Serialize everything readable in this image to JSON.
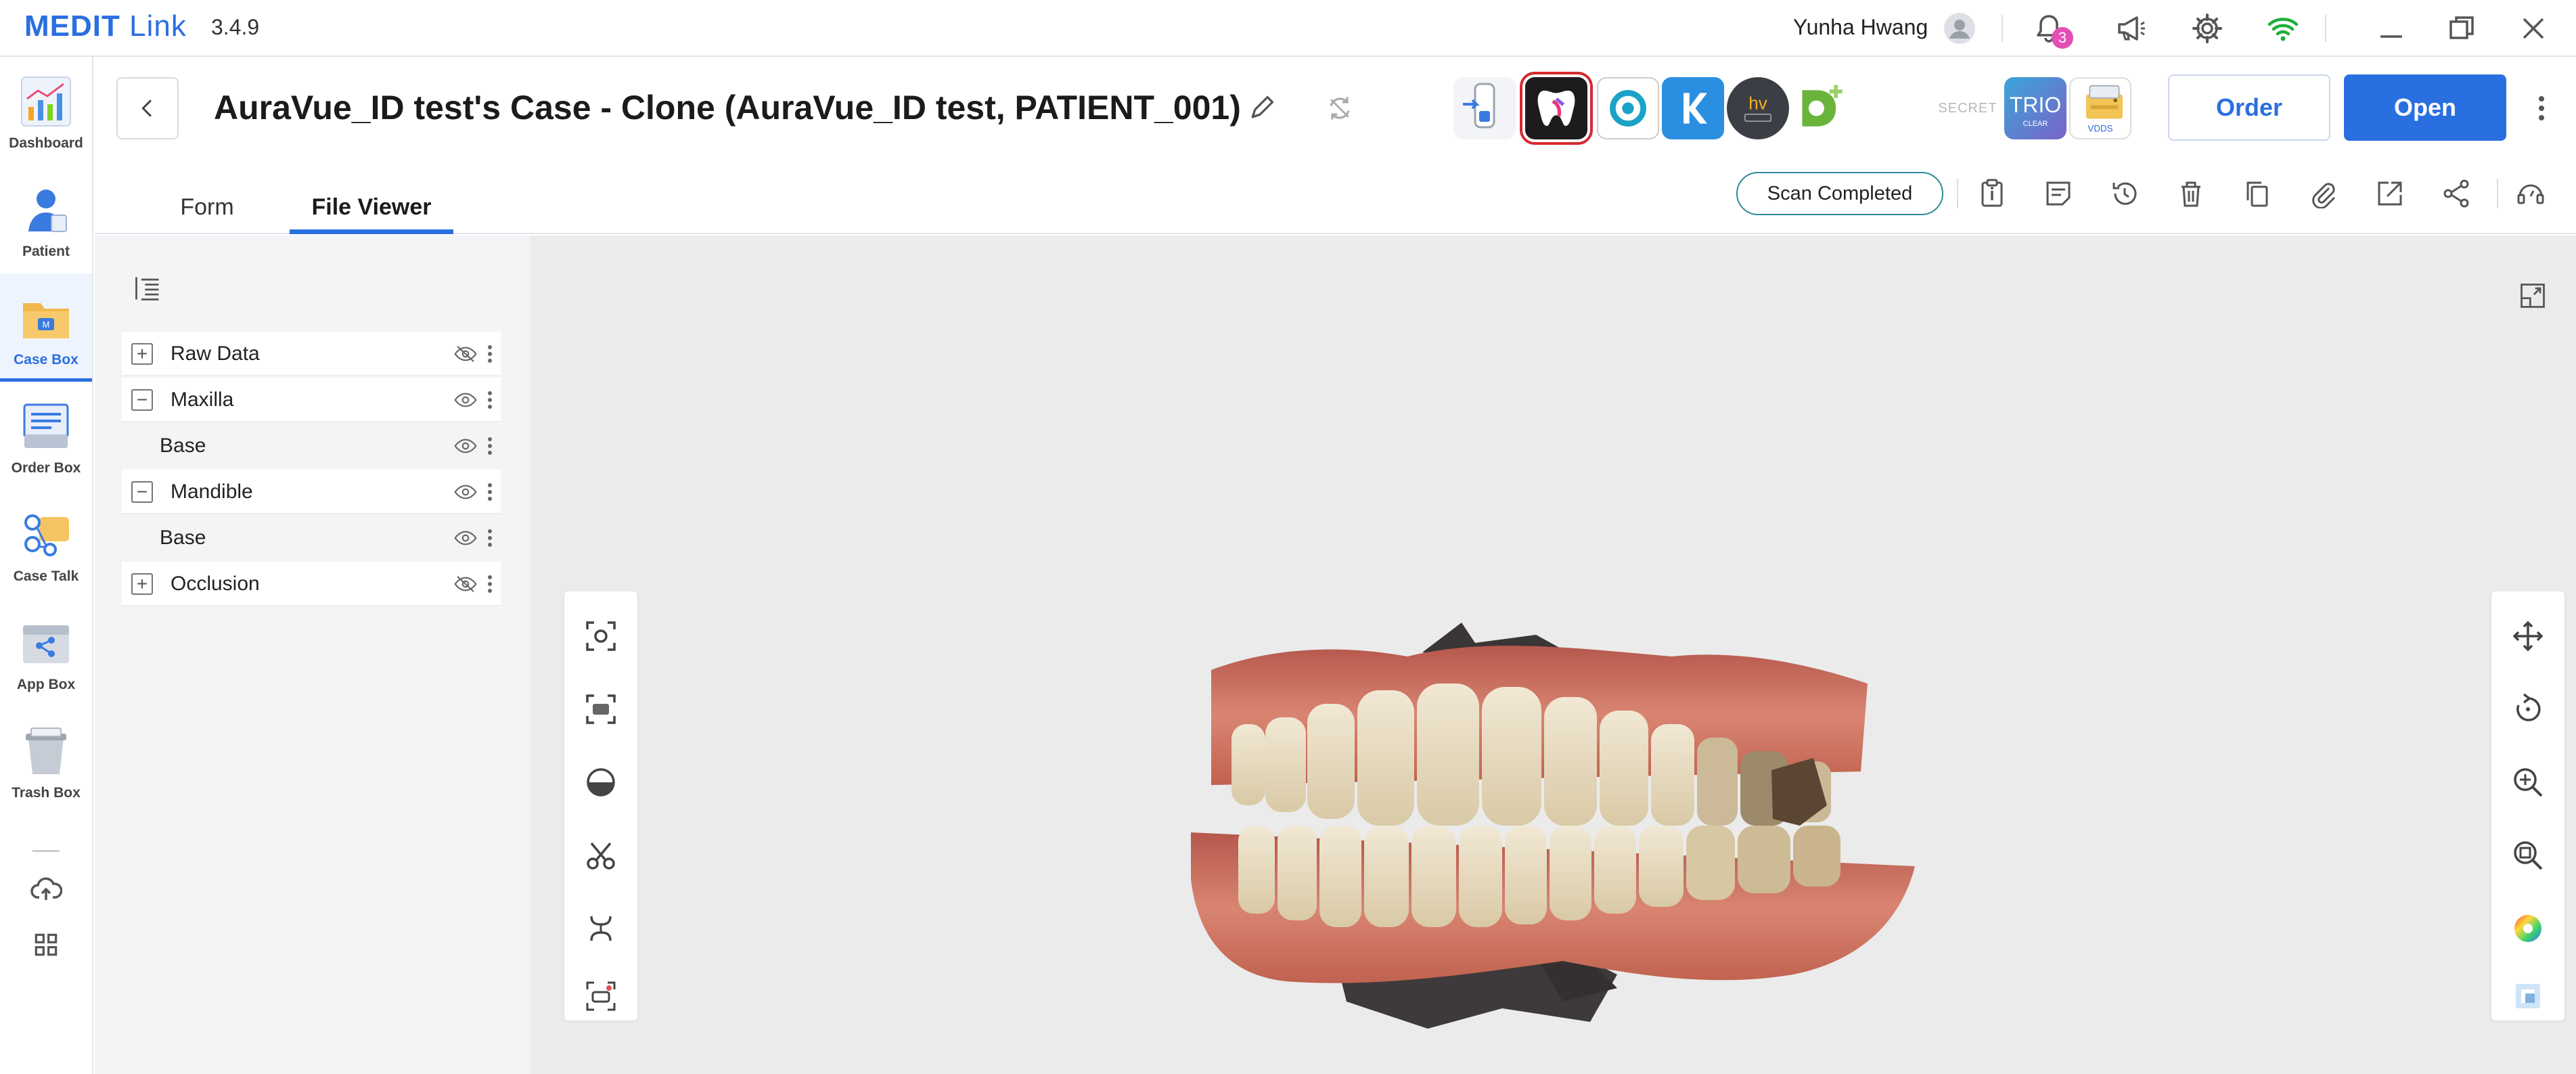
{
  "app": {
    "name_bold": "MEDIT",
    "name_rest": " Link",
    "version": "3.4.9"
  },
  "titlebar": {
    "user_name": "Yunha Hwang",
    "notification_count": "3",
    "icons": [
      "avatar-icon",
      "bell-icon",
      "megaphone-icon",
      "gear-icon",
      "wifi-icon",
      "minimize-icon",
      "restore-icon",
      "close-icon"
    ]
  },
  "sidebar": {
    "items": [
      {
        "label": "Dashboard",
        "icon": "dashboard-icon"
      },
      {
        "label": "Patient",
        "icon": "patient-icon"
      },
      {
        "label": "Case Box",
        "icon": "case-box-icon",
        "active": true
      },
      {
        "label": "Order Box",
        "icon": "order-box-icon"
      },
      {
        "label": "Case Talk",
        "icon": "case-talk-icon"
      },
      {
        "label": "App Box",
        "icon": "app-box-icon"
      },
      {
        "label": "Trash Box",
        "icon": "trash-box-icon"
      }
    ],
    "bottom_icons": [
      "cloud-upload-icon",
      "grid-icon"
    ]
  },
  "header": {
    "case_title": "AuraVue_ID test's Case - Clone (AuraVue_ID test, PATIENT_001)",
    "app_icons_trio_label": "TRIO",
    "app_icons_trio_sub": "CLEAR",
    "app_icons_vdds_label": "VDDS",
    "app_icons_secret_label": "SECRET",
    "order_label": "Order",
    "open_label": "Open",
    "tabs": [
      {
        "label": "Form"
      },
      {
        "label": "File Viewer",
        "active": true
      }
    ],
    "status": "Scan Completed"
  },
  "tree": {
    "rows": [
      {
        "label": "Raw Data",
        "toggle": "+",
        "visible": false,
        "child": false
      },
      {
        "label": "Maxilla",
        "toggle": "−",
        "visible": true,
        "child": false
      },
      {
        "label": "Base",
        "toggle": "",
        "visible": true,
        "child": true
      },
      {
        "label": "Mandible",
        "toggle": "−",
        "visible": true,
        "child": false
      },
      {
        "label": "Base",
        "toggle": "",
        "visible": true,
        "child": true
      },
      {
        "label": "Occlusion",
        "toggle": "+",
        "visible": false,
        "child": false
      }
    ]
  },
  "colors": {
    "accent": "#2a6fe0",
    "status_border": "#2b8a9a",
    "selected_frame": "#d5292f"
  }
}
